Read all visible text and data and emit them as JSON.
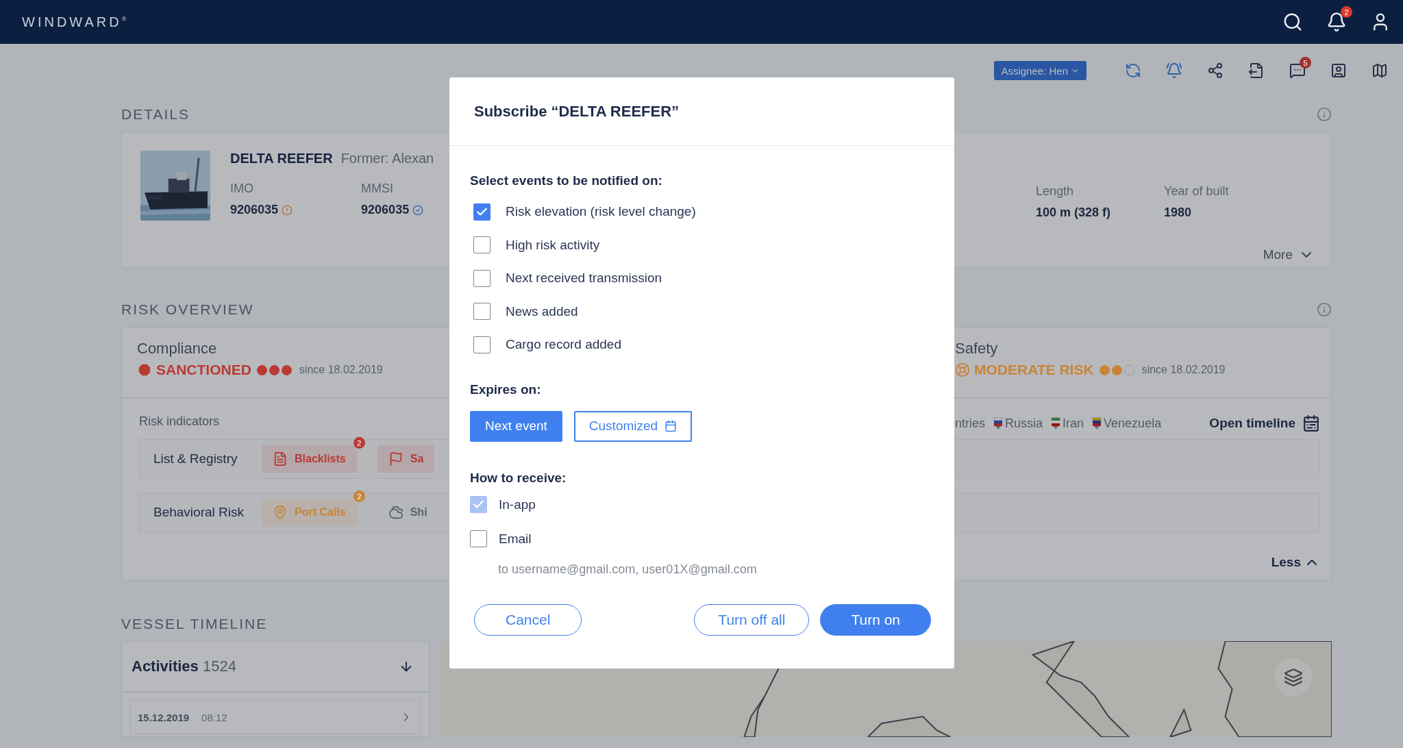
{
  "topbar": {
    "logo": "WINDWARD",
    "logo_mark": "®",
    "notifications_badge": "2"
  },
  "toolbar": {
    "assignee": "Assignee: Hen",
    "chat_badge": "5"
  },
  "details": {
    "title": "DETAILS",
    "vessel_name": "DELTA REEFER",
    "former": "Former: Alexan",
    "fields": [
      {
        "label": "IMO",
        "value": "9206035",
        "verified": false
      },
      {
        "label": "MMSI",
        "value": "9206035",
        "verified": true
      }
    ],
    "right_fields": [
      {
        "label": "Length",
        "value": "100 m (328 f)"
      },
      {
        "label": "Year of built",
        "value": "1980"
      }
    ],
    "more": "More"
  },
  "risk_overview": {
    "title": "RISK OVERVIEW",
    "compliance": {
      "title": "Compliance",
      "status": "SANCTIONED",
      "kind": "octagon",
      "color": "#b93a32",
      "stars": 3,
      "since": "since 18.02.2019"
    },
    "safety": {
      "title": "Safety",
      "status": "MODERATE RISK",
      "kind": "ring",
      "color": "#c98438",
      "stars": 2,
      "since": "since 18.02.2019"
    },
    "indicators_title": "Risk indicators",
    "countries_label": "ntries",
    "countries": [
      {
        "name": "Russia"
      },
      {
        "name": "Iran"
      },
      {
        "name": "Venezuela"
      }
    ],
    "open_timeline": "Open timeline",
    "rows": [
      {
        "label": "List & Registry",
        "chips": [
          {
            "label": "Blacklists",
            "color": "#b93a32",
            "badge": "2",
            "kind": "document"
          },
          {
            "label": "Sa",
            "color": "#b93a32",
            "kind": "flag"
          }
        ]
      },
      {
        "label": "Behavioral Risk",
        "chips": [
          {
            "label": "Port Calls",
            "color": "#c98438",
            "badge": "2",
            "kind": "pin"
          },
          {
            "label": "Shi",
            "color": "#5c6270",
            "kind": "cloud"
          }
        ]
      }
    ],
    "less": "Less"
  },
  "timeline": {
    "title": "VESSEL TIMELINE",
    "activities_label": "Activities",
    "activities_count": "1524",
    "rows": [
      {
        "date": "15.12.2019",
        "time": "08:12"
      }
    ]
  },
  "modal": {
    "title": "Subscribe “DELTA REEFER”",
    "events_label": "Select events to be notified on:",
    "events": [
      {
        "label": "Risk elevation (risk level change)",
        "checked": true
      },
      {
        "label": "High risk activity",
        "checked": false
      },
      {
        "label": "Next received transmission",
        "checked": false
      },
      {
        "label": "News added",
        "checked": false
      },
      {
        "label": "Cargo record added",
        "checked": false
      }
    ],
    "expires_label": "Expires on:",
    "expires_options": [
      {
        "label": "Next event",
        "selected": true,
        "kind": "plain"
      },
      {
        "label": "Customized",
        "selected": false,
        "kind": "calendar"
      }
    ],
    "receive_label": "How to receive:",
    "channels": [
      {
        "label": "In-app",
        "checked": true,
        "disabled": true
      },
      {
        "label": "Email",
        "checked": false,
        "disabled": false
      }
    ],
    "email_note": "to username@gmail.com, user01X@gmail.com",
    "buttons": [
      {
        "label": "Cancel",
        "kind": "secondary"
      },
      {
        "label": "Turn off all",
        "kind": "secondary"
      },
      {
        "label": "Turn on",
        "kind": "primary"
      }
    ]
  }
}
